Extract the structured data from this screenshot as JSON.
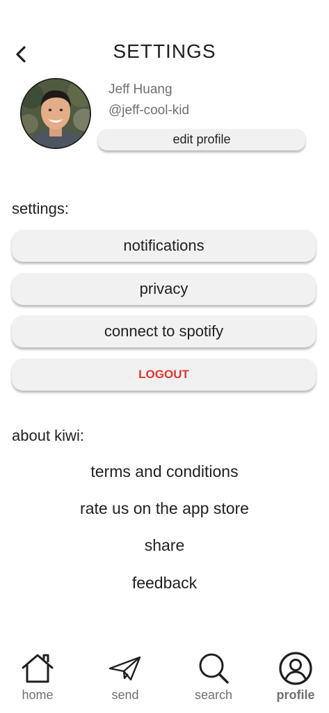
{
  "header": {
    "title": "SETTINGS",
    "back_icon": "chevron-left-icon"
  },
  "profile": {
    "name": "Jeff Huang",
    "handle": "@jeff-cool-kid",
    "edit_label": "edit profile"
  },
  "settings": {
    "title": "settings:",
    "items": [
      {
        "label": "notifications"
      },
      {
        "label": "privacy"
      },
      {
        "label": "connect to spotify"
      },
      {
        "label": "LOGOUT",
        "color": "#e3342f"
      }
    ]
  },
  "about": {
    "title": "about kiwi:",
    "links": [
      {
        "label": "terms and conditions"
      },
      {
        "label": "rate us on the app store"
      },
      {
        "label": "share"
      },
      {
        "label": "feedback"
      }
    ]
  },
  "bottom_nav": {
    "items": [
      {
        "label": "home",
        "icon": "home-icon"
      },
      {
        "label": "send",
        "icon": "paper-plane-icon"
      },
      {
        "label": "search",
        "icon": "search-icon"
      },
      {
        "label": "profile",
        "icon": "user-circle-icon",
        "active": true
      }
    ]
  }
}
